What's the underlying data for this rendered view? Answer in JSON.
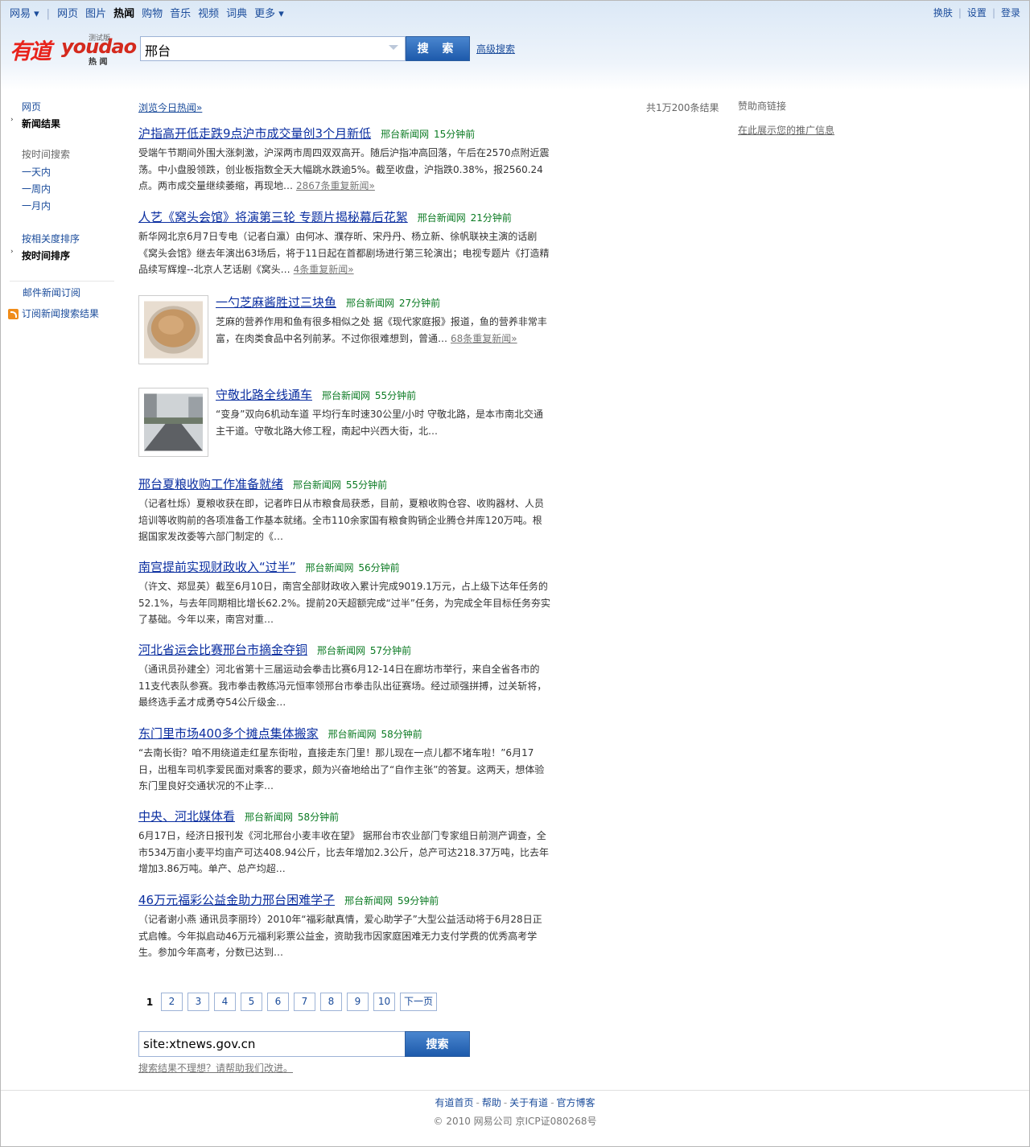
{
  "topnav": {
    "items": [
      "网易 ▾",
      "网页",
      "图片",
      "热闻",
      "购物",
      "音乐",
      "视频",
      "词典",
      "更多 ▾"
    ],
    "right": [
      "换肤",
      "设置",
      "登录"
    ]
  },
  "logo": {
    "cn": "有道",
    "en": "youdao",
    "beta": "测试版",
    "sub": "热 闻"
  },
  "search": {
    "value": "邢台",
    "button": "搜 索",
    "advanced": "高级搜索"
  },
  "sidebar": {
    "web": "网页",
    "news": "新闻结果",
    "time_search": "按时间搜索",
    "day": "一天内",
    "week": "一周内",
    "month": "一月内",
    "sort_relevance": "按相关度排序",
    "sort_time": "按时间排序",
    "email_sub": "邮件新闻订阅",
    "rss_sub": "订阅新闻搜索结果"
  },
  "browse_today": "浏览今日热闻»",
  "result_count": "共1万200条结果",
  "sponsor": {
    "title": "赞助商链接",
    "link": "在此展示您的推广信息"
  },
  "results": [
    {
      "title": "沪指高开低走跌9点沪市成交量创3个月新低",
      "source": "邢台新闻网",
      "time": "15分钟前",
      "desc": "受端午节期间外围大涨刺激，沪深两市周四双双高开。随后沪指冲高回落，午后在2570点附近震荡。中小盘股领跌，创业板指数全天大幅跳水跌逾5%。截至收盘，沪指跌0.38%，报2560.24点。两市成交量继续萎缩，再现地…",
      "dup": "2867条重复新闻»"
    },
    {
      "title": "人艺《窝头会馆》将演第三轮 专题片揭秘幕后花絮",
      "source": "邢台新闻网",
      "time": "21分钟前",
      "desc": "新华网北京6月7日专电（记者白瀛）由何冰、濮存昕、宋丹丹、杨立新、徐帆联袂主演的话剧《窝头会馆》继去年演出63场后，将于11日起在首都剧场进行第三轮演出；电视专题片《打造精品续写辉煌--北京人艺话剧《窝头…",
      "dup": "4条重复新闻»"
    },
    {
      "title": "一勺芝麻酱胜过三块鱼",
      "source": "邢台新闻网",
      "time": "27分钟前",
      "desc": "芝麻的营养作用和鱼有很多相似之处 据《现代家庭报》报道，鱼的营养非常丰富，在肉类食品中名列前茅。不过你很难想到，曾通…",
      "dup": "68条重复新闻»"
    },
    {
      "title": "守敬北路全线通车",
      "source": "邢台新闻网",
      "time": "55分钟前",
      "desc": "“变身”双向6机动车道 平均行车时速30公里/小时 守敬北路，是本市南北交通主干道。守敬北路大修工程，南起中兴西大街，北…"
    },
    {
      "title": "邢台夏粮收购工作准备就绪",
      "source": "邢台新闻网",
      "time": "55分钟前",
      "desc": "（记者杜烁）夏粮收获在即，记者昨日从市粮食局获悉，目前，夏粮收购仓容、收购器材、人员培训等收购前的各项准备工作基本就绪。全市110余家国有粮食购销企业腾仓并库120万吨。根据国家发改委等六部门制定的《…"
    },
    {
      "title": "南宫提前实现财政收入“过半”",
      "source": "邢台新闻网",
      "time": "56分钟前",
      "desc": "（许文、郑显英）截至6月10日，南宫全部财政收入累计完成9019.1万元，占上级下达年任务的52.1%，与去年同期相比增长62.2%。提前20天超额完成“过半”任务，为完成全年目标任务夯实了基础。今年以来，南宫对重…"
    },
    {
      "title": "河北省运会比赛邢台市摘金夺铜",
      "source": "邢台新闻网",
      "time": "57分钟前",
      "desc": "（通讯员孙建全）河北省第十三届运动会拳击比赛6月12-14日在廊坊市举行，来自全省各市的11支代表队参赛。我市拳击教练冯元恒率领邢台市拳击队出征赛场。经过顽强拼搏，过关斩将，最终选手孟才成勇夺54公斤级金…"
    },
    {
      "title": "东门里市场400多个摊点集体搬家",
      "source": "邢台新闻网",
      "time": "58分钟前",
      "desc": "“去南长街？咱不用绕道走红星东街啦，直接走东门里！那儿现在一点儿都不堵车啦！”6月17日，出租车司机李爱民面对乘客的要求，颇为兴奋地给出了“自作主张”的答复。这两天，想体验东门里良好交通状况的不止李…"
    },
    {
      "title": "中央、河北媒体看",
      "source": "邢台新闻网",
      "time": "58分钟前",
      "desc": "6月17日，经济日报刊发《河北邢台小麦丰收在望》 据邢台市农业部门专家组日前测产调查，全市534万亩小麦平均亩产可达408.94公斤，比去年增加2.3公斤，总产可达218.37万吨，比去年增加3.86万吨。单产、总产均超…"
    },
    {
      "title": "46万元福彩公益金助力邢台困难学子",
      "source": "邢台新闻网",
      "time": "59分钟前",
      "desc": "（记者谢小燕 通讯员李丽玲）2010年“福彩献真情，爱心助学子”大型公益活动将于6月28日正式启帷。今年拟启动46万元福利彩票公益金，资助我市因家庭困难无力支付学费的优秀高考学生。参加今年高考，分数已达到…"
    }
  ],
  "pager": {
    "current": "1",
    "pages": [
      "2",
      "3",
      "4",
      "5",
      "6",
      "7",
      "8",
      "9",
      "10"
    ],
    "next": "下一页"
  },
  "bottom_search": {
    "value": "site:xtnews.gov.cn",
    "button": "搜索",
    "feedback": "搜索结果不理想？请帮助我们改进。"
  },
  "footer": {
    "links": [
      "有道首页",
      "帮助",
      "关于有道",
      "官方博客"
    ],
    "copyright": "© 2010 网易公司 京ICP证080268号"
  }
}
